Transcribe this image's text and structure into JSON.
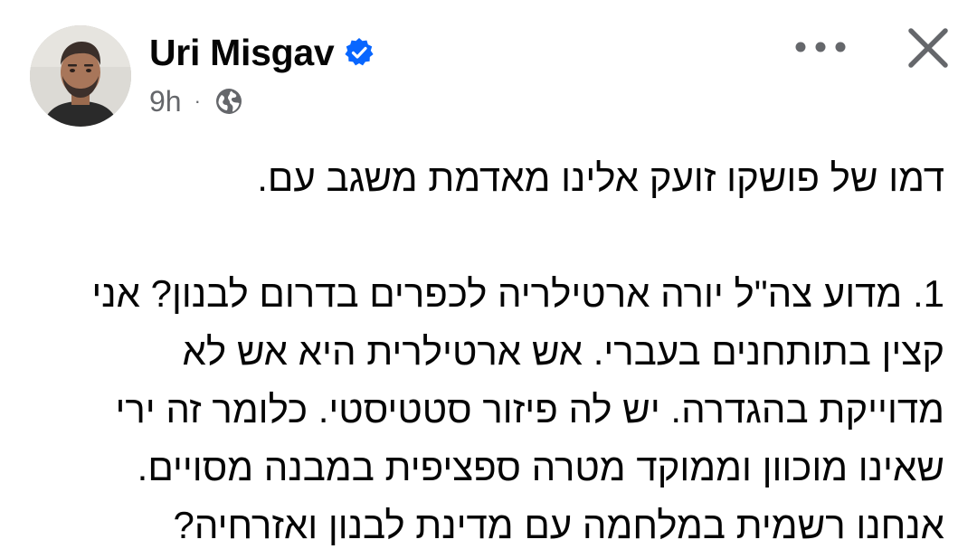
{
  "post": {
    "author": {
      "name": "Uri Misgav",
      "verified_icon": "verified-badge-icon",
      "avatar_icon": "profile-photo"
    },
    "meta": {
      "time": "9h",
      "separator": "·",
      "privacy_icon": "globe-icon"
    },
    "actions": {
      "more_icon": "more-options-icon",
      "close_icon": "close-icon"
    },
    "body": {
      "paragraph_1": [
        "דמו של פושקו זועק אלינו מאדמת משגב עם."
      ],
      "paragraph_2": [
        "1. מדוע צה\"ל יורה ארטילריה לכפרים בדרום לבנון? אני",
        "קצין בתותחנים בעברי. אש ארטילרית היא אש לא",
        "מדוייקת בהגדרה. יש לה פיזור סטטיסטי. כלומר זה ירי",
        "שאינו מוכוון וממוקד מטרה ספציפית במבנה מסויים.",
        "אנחנו רשמית במלחמה עם מדינת לבנון ואזרחיה?"
      ]
    },
    "colors": {
      "verified_blue": "#0866ff",
      "secondary_text": "#65676b",
      "primary_text": "#050505"
    }
  }
}
